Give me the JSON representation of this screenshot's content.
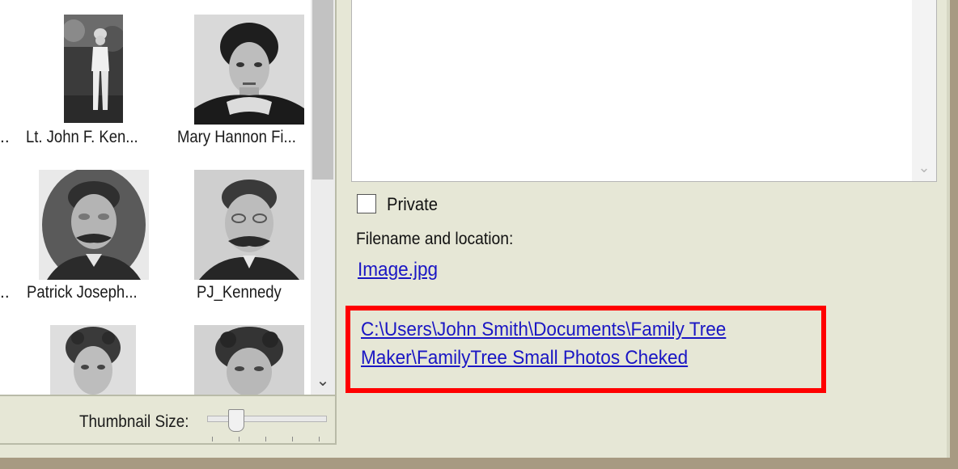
{
  "thumbnails": [
    {
      "name": "Lt. John F. Ken..."
    },
    {
      "name": "Mary Hannon Fi..."
    },
    {
      "name": "Patrick Joseph..."
    },
    {
      "name": "PJ_Kennedy"
    },
    {
      "name": ""
    },
    {
      "name": ""
    }
  ],
  "truncated_left_label": "..",
  "thumbnail_size": {
    "label": "Thumbnail Size:",
    "level": 0.2
  },
  "details": {
    "private_label": "Private",
    "private_checked": false,
    "filename_label": "Filename and location:",
    "filename": "Image.jpg",
    "path_line1": "C:\\Users\\John Smith\\Documents\\Family Tree",
    "path_line2": "Maker\\FamilyTree Small Photos Cheked"
  },
  "icons": {
    "list_scroll_down": "chevron-down-icon",
    "notes_scroll_down": "chevron-down-icon"
  },
  "colors": {
    "panel_bg": "#e6e7d6",
    "link": "#1a16c4",
    "highlight_border": "#ff0000"
  }
}
